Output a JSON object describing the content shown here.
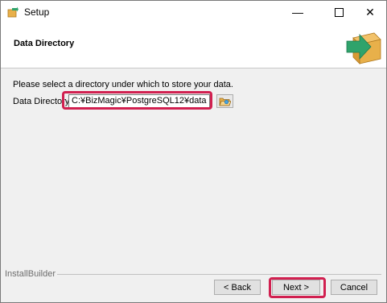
{
  "window": {
    "title": "Setup",
    "controls": {
      "minimize": "—",
      "close": "✕"
    }
  },
  "header": {
    "title": "Data Directory",
    "icon": "install-box-arrow-icon"
  },
  "body": {
    "prompt": "Please select a directory under which to store your data.",
    "field_label": "Data Directory",
    "field_value": "C:¥BizMagic¥PostgreSQL12¥data",
    "browse_icon": "folder-open-icon"
  },
  "footer": {
    "brand": "InstallBuilder",
    "back_label": "< Back",
    "next_label": "Next >",
    "cancel_label": "Cancel"
  },
  "colors": {
    "highlight": "#d12050",
    "arrow": "#2fa36b",
    "box": "#e8b04a"
  }
}
